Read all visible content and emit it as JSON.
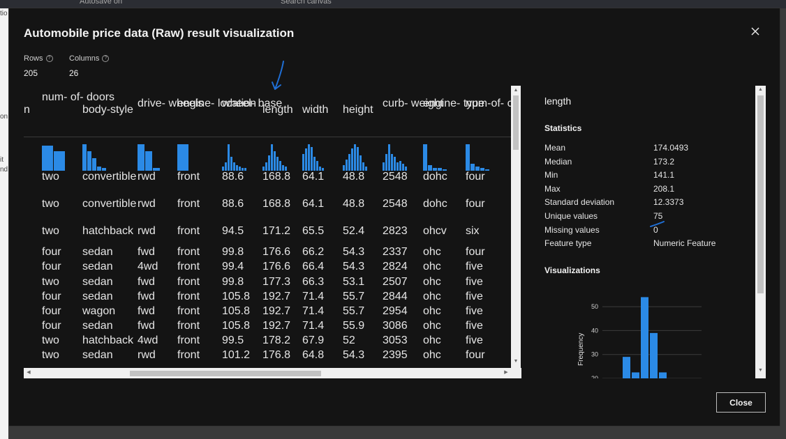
{
  "background": {
    "toolbar_text": "Autosave on",
    "search_placeholder": "Search canvas",
    "left_fragments": [
      "tio",
      "on",
      "it",
      "nd"
    ]
  },
  "dialog": {
    "title": "Automobile price data (Raw) result visualization",
    "rows_label": "Rows",
    "rows_value": "205",
    "columns_label": "Columns",
    "columns_value": "26",
    "close_button_label": "Close"
  },
  "table": {
    "columns": [
      {
        "key": "n",
        "header": "n",
        "has_spark": false
      },
      {
        "key": "doors",
        "header": "num-\nof-\ndoors",
        "spark": [
          0.9,
          0.7
        ]
      },
      {
        "key": "body",
        "header": "body-style",
        "spark": [
          0.95,
          0.7,
          0.45,
          0.15,
          0.1
        ]
      },
      {
        "key": "drive",
        "header": "drive-\nwheels",
        "spark": [
          0.95,
          0.7,
          0.1
        ]
      },
      {
        "key": "engloc",
        "header": "engine-\nlocation",
        "spark": [
          0.95
        ]
      },
      {
        "key": "wheelbase",
        "header": "wheel-\nbase",
        "spark": [
          0.15,
          0.3,
          0.95,
          0.5,
          0.3,
          0.2,
          0.15,
          0.1,
          0.1
        ]
      },
      {
        "key": "length",
        "header": "length",
        "spark": [
          0.15,
          0.3,
          0.55,
          0.95,
          0.7,
          0.5,
          0.35,
          0.2,
          0.15
        ]
      },
      {
        "key": "width",
        "header": "width",
        "spark": [
          0.6,
          0.8,
          0.95,
          0.85,
          0.5,
          0.35,
          0.15,
          0.1
        ]
      },
      {
        "key": "height",
        "header": "height",
        "spark": [
          0.2,
          0.4,
          0.6,
          0.8,
          0.95,
          0.85,
          0.55,
          0.3,
          0.15
        ]
      },
      {
        "key": "curb",
        "header": "curb-\nweight",
        "spark": [
          0.3,
          0.6,
          0.95,
          0.6,
          0.5,
          0.3,
          0.35,
          0.25,
          0.15
        ]
      },
      {
        "key": "engtype",
        "header": "engine-\ntype",
        "spark": [
          0.95,
          0.2,
          0.1,
          0.1,
          0.05
        ]
      },
      {
        "key": "cyl",
        "header": "num-of-\ncylinders",
        "spark": [
          0.95,
          0.25,
          0.15,
          0.1,
          0.05
        ]
      }
    ],
    "rows": [
      [
        "",
        "two",
        "convertible",
        "rwd",
        "front",
        "88.6",
        "168.8",
        "64.1",
        "48.8",
        "2548",
        "dohc",
        "four"
      ],
      [
        "",
        "two",
        "convertible",
        "rwd",
        "front",
        "88.6",
        "168.8",
        "64.1",
        "48.8",
        "2548",
        "dohc",
        "four"
      ],
      [
        "",
        "two",
        "hatchback",
        "rwd",
        "front",
        "94.5",
        "171.2",
        "65.5",
        "52.4",
        "2823",
        "ohcv",
        "six"
      ],
      [
        "",
        "four",
        "sedan",
        "fwd",
        "front",
        "99.8",
        "176.6",
        "66.2",
        "54.3",
        "2337",
        "ohc",
        "four"
      ],
      [
        "",
        "four",
        "sedan",
        "4wd",
        "front",
        "99.4",
        "176.6",
        "66.4",
        "54.3",
        "2824",
        "ohc",
        "five"
      ],
      [
        "",
        "two",
        "sedan",
        "fwd",
        "front",
        "99.8",
        "177.3",
        "66.3",
        "53.1",
        "2507",
        "ohc",
        "five"
      ],
      [
        "",
        "four",
        "sedan",
        "fwd",
        "front",
        "105.8",
        "192.7",
        "71.4",
        "55.7",
        "2844",
        "ohc",
        "five"
      ],
      [
        "",
        "four",
        "wagon",
        "fwd",
        "front",
        "105.8",
        "192.7",
        "71.4",
        "55.7",
        "2954",
        "ohc",
        "five"
      ],
      [
        "",
        "four",
        "sedan",
        "fwd",
        "front",
        "105.8",
        "192.7",
        "71.4",
        "55.9",
        "3086",
        "ohc",
        "five"
      ],
      [
        "",
        "two",
        "hatchback",
        "4wd",
        "front",
        "99.5",
        "178.2",
        "67.9",
        "52",
        "3053",
        "ohc",
        "five"
      ],
      [
        "",
        "two",
        "sedan",
        "rwd",
        "front",
        "101.2",
        "176.8",
        "64.8",
        "54.3",
        "2395",
        "ohc",
        "four"
      ]
    ]
  },
  "side": {
    "column_name": "length",
    "statistics_heading": "Statistics",
    "stats": [
      {
        "label": "Mean",
        "value": "174.0493"
      },
      {
        "label": "Median",
        "value": "173.2"
      },
      {
        "label": "Min",
        "value": "141.1"
      },
      {
        "label": "Max",
        "value": "208.1"
      },
      {
        "label": "Standard deviation",
        "value": "12.3373"
      },
      {
        "label": "Unique values",
        "value": "75"
      },
      {
        "label": "Missing values",
        "value": "0"
      },
      {
        "label": "Feature type",
        "value": "Numeric Feature"
      }
    ],
    "visualizations_heading": "Visualizations"
  },
  "chart_data": {
    "type": "bar",
    "ylabel": "Frequency",
    "yticks": [
      20,
      30,
      40,
      50
    ],
    "ylim": [
      20,
      55
    ],
    "values": [
      29,
      22.5,
      54,
      39,
      22.5
    ],
    "color": "#2b8ae6"
  },
  "colors": {
    "accent": "#2b8ae6",
    "dialog_bg": "#141414",
    "annotation": "#1f6fd6"
  }
}
